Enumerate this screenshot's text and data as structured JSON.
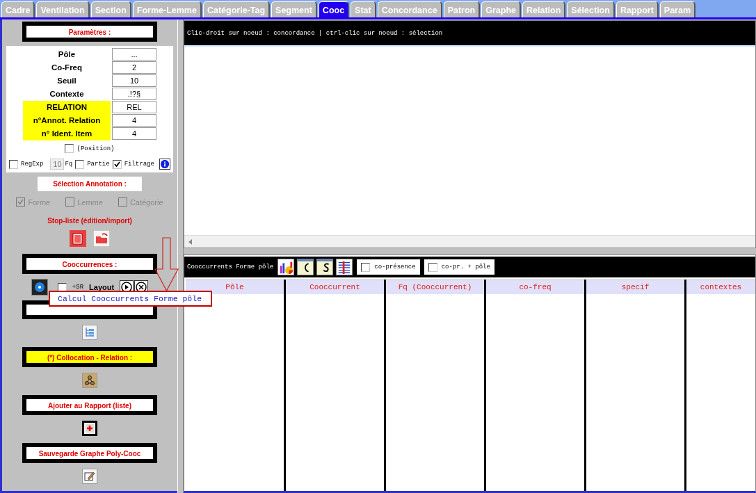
{
  "tabs": [
    {
      "label": "Cadre",
      "selected": false
    },
    {
      "label": "Ventilation",
      "selected": false
    },
    {
      "label": "Section",
      "selected": false
    },
    {
      "label": "Forme-Lemme",
      "selected": false
    },
    {
      "label": "Catégorie-Tag",
      "selected": false
    },
    {
      "label": "Segment",
      "selected": false
    },
    {
      "label": "Cooc",
      "selected": true
    },
    {
      "label": "Stat",
      "selected": false
    },
    {
      "label": "Concordance",
      "selected": false
    },
    {
      "label": "Patron",
      "selected": false
    },
    {
      "label": "Graphe",
      "selected": false
    },
    {
      "label": "Relation",
      "selected": false
    },
    {
      "label": "Sélection",
      "selected": false
    },
    {
      "label": "Rapport",
      "selected": false
    },
    {
      "label": "Param",
      "selected": false
    }
  ],
  "left_panel": {
    "parameters_title": "Paramètres :",
    "parameters": [
      {
        "label": "Pôle",
        "value": "...",
        "highlighted": false
      },
      {
        "label": "Co-Freq",
        "value": "2",
        "highlighted": false
      },
      {
        "label": "Seuil",
        "value": "10",
        "highlighted": false
      },
      {
        "label": "Contexte",
        "value": ".!?§",
        "highlighted": false
      },
      {
        "label": "RELATION",
        "value": "REL",
        "highlighted": true
      },
      {
        "label": "n°Annot. Relation",
        "value": "4",
        "highlighted": true
      },
      {
        "label": "n° Ident. Item",
        "value": "4",
        "highlighted": true
      }
    ],
    "position": {
      "label": "(Position)",
      "checked": false
    },
    "options": [
      {
        "kind": "checkbox",
        "label": "RegExp",
        "checked": false
      },
      {
        "kind": "number",
        "value": "10",
        "unit": "Fq",
        "disabled": true
      },
      {
        "kind": "checkbox",
        "label": "Partie",
        "checked": false
      },
      {
        "kind": "checkbox",
        "label": "Filtrage",
        "checked": true
      },
      {
        "kind": "info"
      }
    ],
    "annotation_title": "Sélection Annotation :",
    "annotation_options": [
      {
        "label": "Forme",
        "checked": true,
        "disabled": true
      },
      {
        "label": "Lemme",
        "checked": false,
        "disabled": true
      },
      {
        "label": "Catégorie",
        "checked": false,
        "disabled": true
      }
    ],
    "stoplist_title": "Stop-liste (édition/import)",
    "cooc_title": "Cooccurrences :",
    "sr_option": {
      "label": "+SR",
      "checked": false
    },
    "layout_label": "Layout",
    "collocation_title": "(*) Collocation - Relation :",
    "report_title": "Ajouter au Rapport (liste)",
    "save_title": "Sauvegarde Graphe Poly-Cooc"
  },
  "graph_pane": {
    "hint": "Clic-droit sur noeud : concordance | ctrl-clic sur noeud : sélection"
  },
  "results_pane": {
    "title": "Cooccurrents Forme pôle",
    "toggles": [
      {
        "label": "co-présence",
        "checked": false
      },
      {
        "label": "co-pr. + pôle",
        "checked": false
      }
    ],
    "columns": [
      "Pôle",
      "Cooccurrent",
      "Fq (Cooccurrent)",
      "co-freq",
      "specif",
      "contextes"
    ]
  },
  "tooltip": {
    "text": "Calcul Cooccurrents Forme pôle"
  }
}
